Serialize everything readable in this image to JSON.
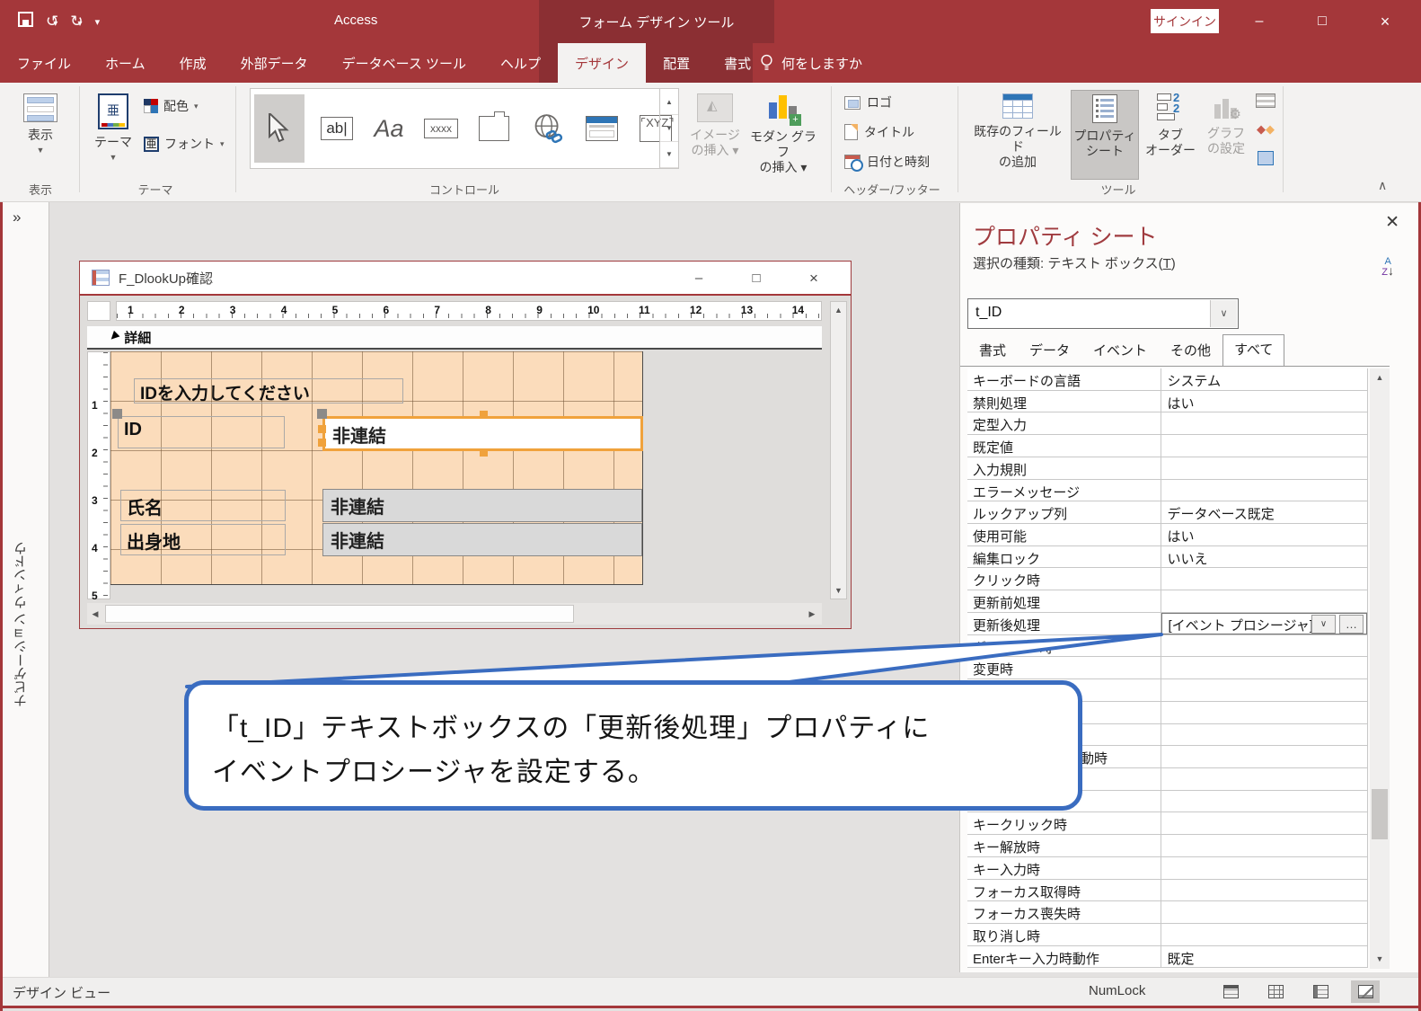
{
  "app": {
    "title": "Access",
    "context_title": "フォーム デザイン ツール",
    "sign_in": "サインイン",
    "minimize": "–",
    "maximize": "□",
    "close": "×"
  },
  "ribbon": {
    "tabs": [
      {
        "label": "ファイル"
      },
      {
        "label": "ホーム"
      },
      {
        "label": "作成"
      },
      {
        "label": "外部データ"
      },
      {
        "label": "データベース ツール"
      },
      {
        "label": "ヘルプ"
      },
      {
        "label": "デザイン",
        "active": true,
        "contextual": true
      },
      {
        "label": "配置",
        "contextual": true
      },
      {
        "label": "書式",
        "contextual": true
      }
    ],
    "tell_me": "何をしますか",
    "view_group": {
      "button": "表示",
      "group_label": "表示"
    },
    "theme_group": {
      "theme": "テーマ",
      "colors": "配色",
      "fonts": "フォント",
      "group_label": "テーマ"
    },
    "controls_group": {
      "group_label": "コントロール",
      "ab": "ab",
      "aa": "Aa",
      "xxxx": "xxxx",
      "xyz": "XYZ",
      "insert_image_line1": "イメージ",
      "insert_image_line2": "の挿入 ▾",
      "insert_chart_line1": "モダン グラフ",
      "insert_chart_line2": "の挿入 ▾"
    },
    "header_footer_group": {
      "logo": "ロゴ",
      "title": "タイトル",
      "datetime": "日付と時刻",
      "group_label": "ヘッダー/フッター"
    },
    "tools_group": {
      "group_label": "ツール",
      "add_fields_line1": "既存のフィールド",
      "add_fields_line2": "の追加",
      "property_sheet_line1": "プロパティ",
      "property_sheet_line2": "シート",
      "tab_order_line1": "タブ",
      "tab_order_line2": "オーダー",
      "chart_settings_line1": "グラフ",
      "chart_settings_line2": "の設定"
    }
  },
  "nav_pane": {
    "label": "ナビゲーション ウィンドウ"
  },
  "form_window": {
    "title": "F_DlookUp確認",
    "section_label": "詳細",
    "h_ruler": [
      "1",
      "2",
      "3",
      "4",
      "5",
      "6",
      "7",
      "8",
      "9",
      "10",
      "11",
      "12",
      "13",
      "14"
    ],
    "v_ruler": [
      "1",
      "2",
      "3",
      "4",
      "5"
    ],
    "caption_label": "IDを入力してください",
    "unbound_text": "非連結",
    "fields": [
      {
        "label": "ID",
        "value": "非連結",
        "selected": true
      },
      {
        "label": "氏名",
        "value": "非連結",
        "selected": false
      },
      {
        "label": "出身地",
        "value": "非連結",
        "selected": false
      }
    ]
  },
  "callout": {
    "line1": "「t_ID」テキストボックスの「更新後処理」プロパティに",
    "line2": "イベントプロシージャを設定する。"
  },
  "property_sheet": {
    "title": "プロパティ シート",
    "selection_prefix": "選択の種類: テキスト ボックス(",
    "selection_mnemonic": "T",
    "selection_suffix": ")",
    "object_name": "t_ID",
    "tabs": [
      {
        "label": "書式"
      },
      {
        "label": "データ"
      },
      {
        "label": "イベント"
      },
      {
        "label": "その他"
      },
      {
        "label": "すべて",
        "active": true
      }
    ],
    "rows": [
      {
        "label": "キーボードの言語",
        "value": "システム"
      },
      {
        "label": "禁則処理",
        "value": "はい"
      },
      {
        "label": "定型入力",
        "value": ""
      },
      {
        "label": "既定値",
        "value": ""
      },
      {
        "label": "入力規則",
        "value": ""
      },
      {
        "label": "エラーメッセージ",
        "value": ""
      },
      {
        "label": "ルックアップ列",
        "value": "データベース既定"
      },
      {
        "label": "使用可能",
        "value": "はい"
      },
      {
        "label": "編集ロック",
        "value": "いいえ"
      },
      {
        "label": "クリック時",
        "value": ""
      },
      {
        "label": "更新前処理",
        "value": ""
      },
      {
        "label": "更新後処理",
        "value": "[イベント プロシージャ]",
        "selected": true
      },
      {
        "label": "ダーティー時",
        "value": ""
      },
      {
        "label": "変更時",
        "value": ""
      },
      {
        "label": "",
        "value": ""
      },
      {
        "label": "",
        "value": ""
      },
      {
        "label": "",
        "value": ""
      },
      {
        "label": "マウスポインタ移動時",
        "value": ""
      },
      {
        "label": "",
        "value": ""
      },
      {
        "label": "",
        "value": ""
      },
      {
        "label": "キークリック時",
        "value": ""
      },
      {
        "label": "キー解放時",
        "value": ""
      },
      {
        "label": "キー入力時",
        "value": ""
      },
      {
        "label": "フォーカス取得時",
        "value": ""
      },
      {
        "label": "フォーカス喪失時",
        "value": ""
      },
      {
        "label": "取り消し時",
        "value": ""
      },
      {
        "label": "Enterキー入力時動作",
        "value": "既定"
      }
    ]
  },
  "status_bar": {
    "view_label": "デザイン ビュー",
    "numlock": "NumLock"
  },
  "colors": {
    "brand": "#A4373A",
    "context": "#8B2F33",
    "accent_orange": "#F0A23C",
    "callout_blue": "#3A6CC0",
    "grid_bg": "#FBDCBB"
  }
}
